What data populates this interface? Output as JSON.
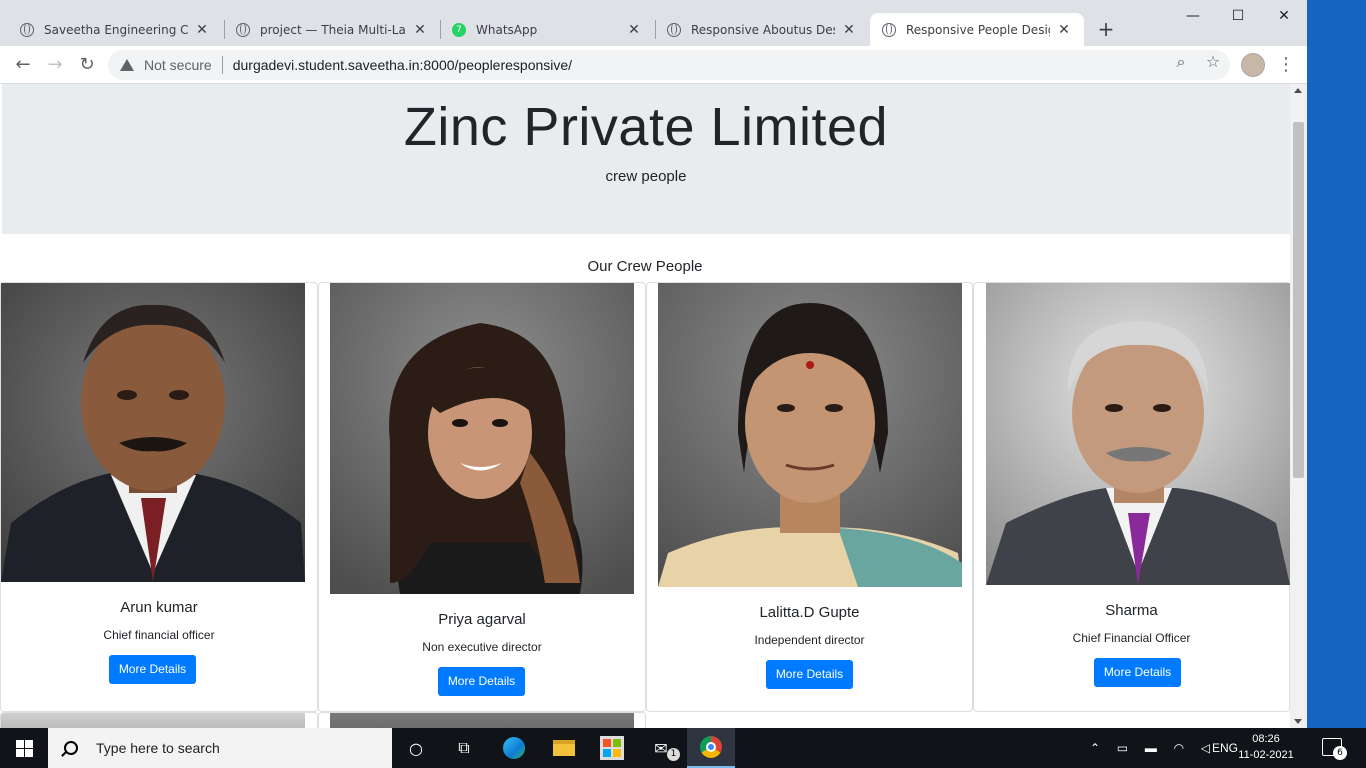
{
  "browser": {
    "tabs": [
      {
        "label": "Saveetha Engineering College",
        "icon": "globe-icon"
      },
      {
        "label": "project — Theia Multi-Language",
        "icon": "globe-icon"
      },
      {
        "label": "WhatsApp",
        "icon": "whatsapp-icon",
        "badge": "7"
      },
      {
        "label": "Responsive Aboutus Design",
        "icon": "globe-icon"
      },
      {
        "label": "Responsive People Design",
        "icon": "globe-icon",
        "active": true
      }
    ],
    "security_label": "Not secure",
    "url": "durgadevi.student.saveetha.in:8000/peopleresponsive/"
  },
  "page": {
    "title": "Zinc Private Limited",
    "subtitle": "crew people",
    "section_title": "Our Crew People",
    "people": [
      {
        "name": "Arun kumar",
        "role": "Chief financial officer",
        "button": "More Details"
      },
      {
        "name": "Priya agarval",
        "role": "Non executive director",
        "button": "More Details"
      },
      {
        "name": "Lalitta.D Gupte",
        "role": "Independent director",
        "button": "More Details"
      },
      {
        "name": "Sharma",
        "role": "Chief Financial Officer",
        "button": "More Details"
      }
    ]
  },
  "taskbar": {
    "search_placeholder": "Type here to search",
    "mail_badge": "1",
    "language": "ENG",
    "time": "08:26",
    "date": "11-02-2021",
    "notification_count": "6"
  },
  "colors": {
    "primary_button": "#007bff",
    "jumbotron_bg": "#e9ecef",
    "desktop_bg": "#1565c0"
  }
}
